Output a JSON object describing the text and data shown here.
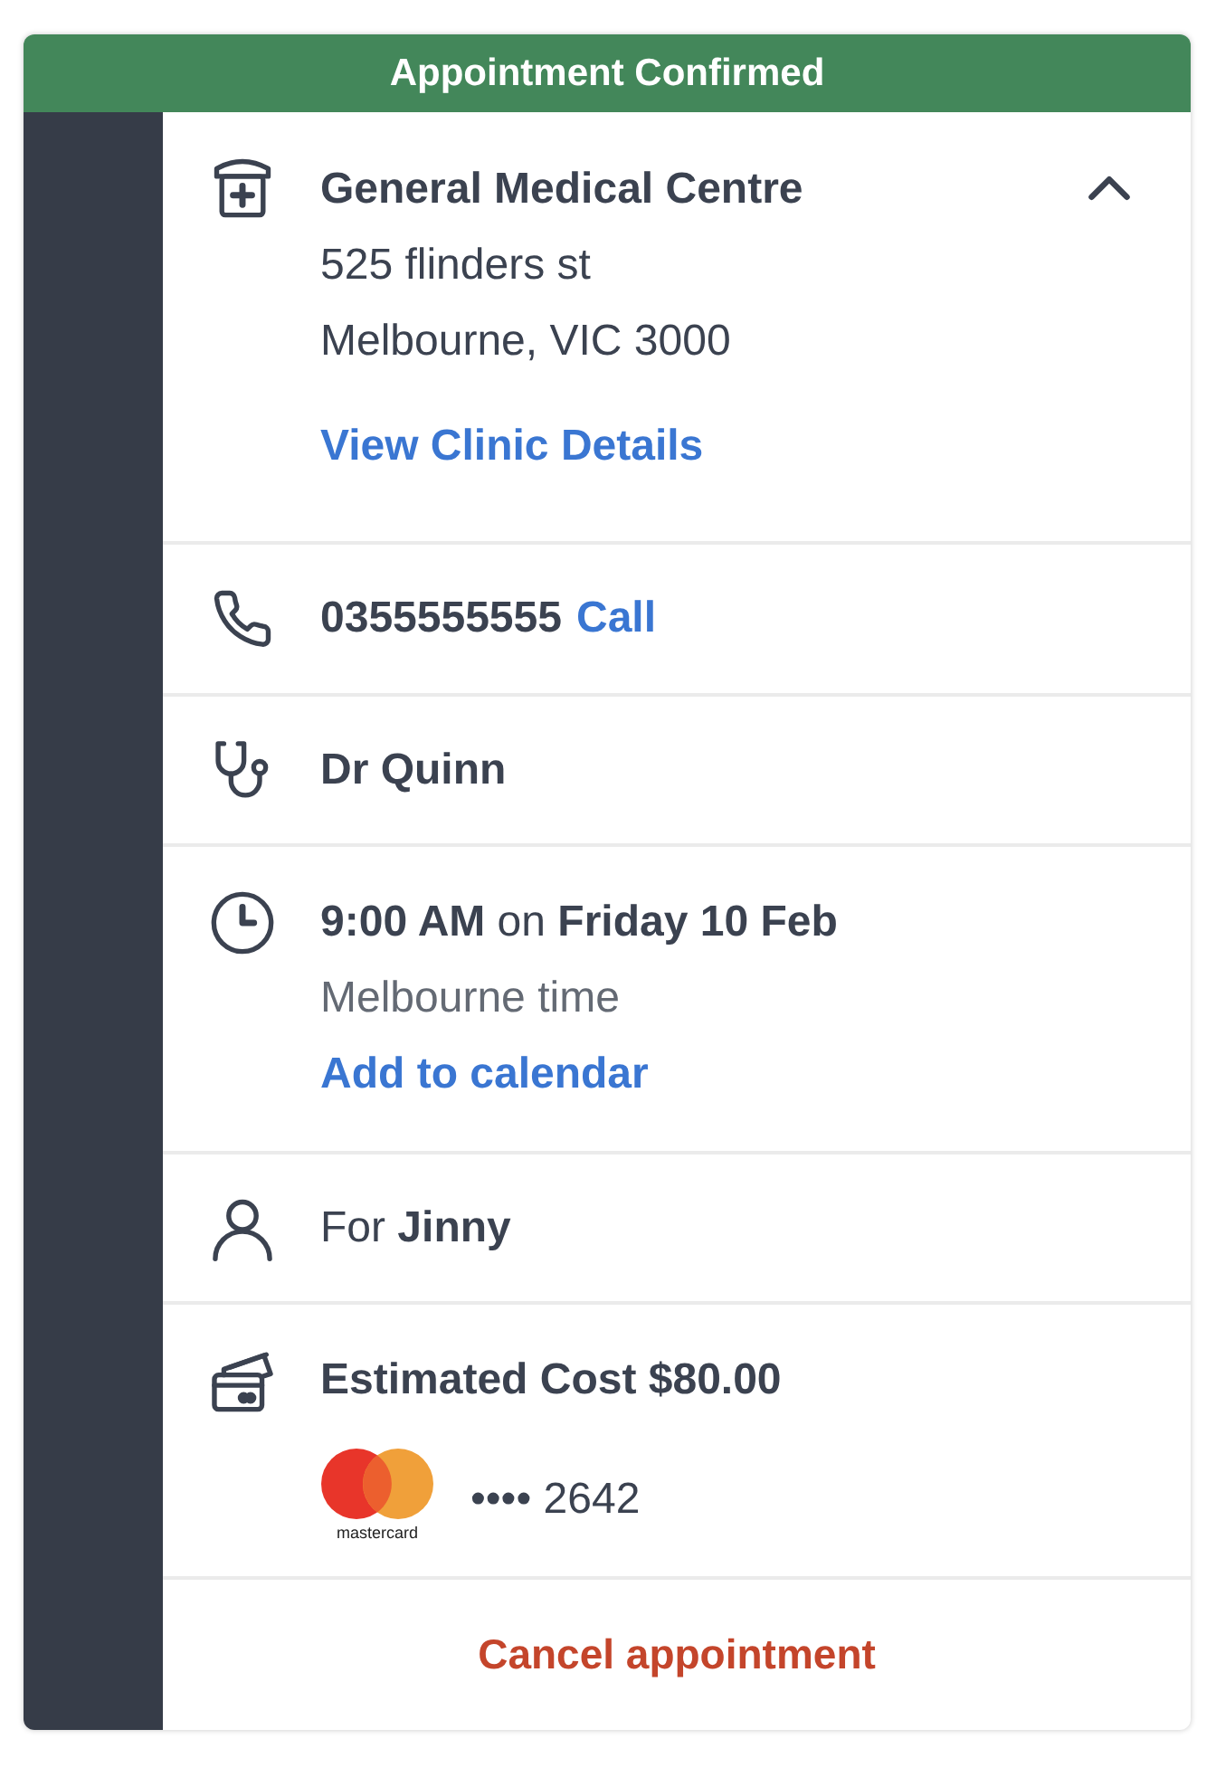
{
  "banner": {
    "title": "Appointment Confirmed"
  },
  "clinic": {
    "name": "General Medical Centre",
    "address": [
      "525 flinders st",
      "Melbourne, VIC 3000"
    ],
    "link": "View Clinic Details",
    "expanded": true
  },
  "rows": [
    {
      "kind": "phone",
      "text": "0355555555",
      "link": "Call"
    },
    {
      "kind": "doctor",
      "text": "Dr Quinn"
    },
    {
      "kind": "time",
      "text": "**9:00 AM** on **Friday 10 Feb**",
      "note": "Melbourne time",
      "link": "Add to calendar"
    },
    {
      "kind": "patient",
      "text": "For **Jinny**"
    },
    {
      "kind": "cost",
      "text": "Estimated Cost $80.00",
      "payment": {
        "brand": "mastercard",
        "number": "•••• 2642"
      }
    }
  ],
  "cancel_button": "Cancel appointment"
}
